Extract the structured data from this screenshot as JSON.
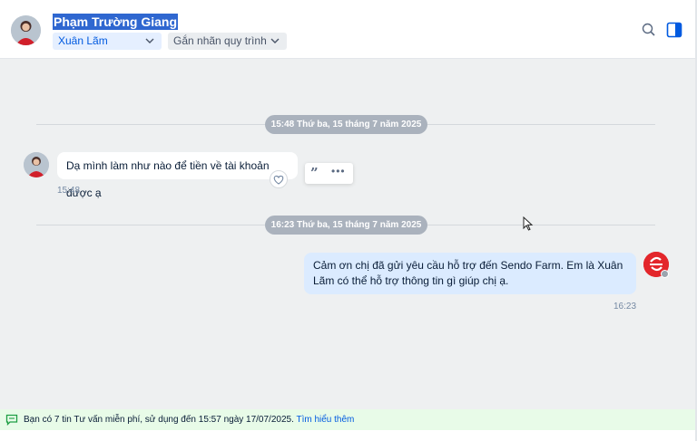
{
  "header": {
    "contact_name": "Phạm Trường Giang",
    "assignee": "Xuân Lãm",
    "label_button": "Gắn nhãn quy trình"
  },
  "chat": {
    "dividers": [
      {
        "label": "15:48 Thứ ba, 15 tháng 7 năm 2025"
      },
      {
        "label": "16:23 Thứ ba, 15 tháng 7 năm 2025"
      }
    ],
    "incoming": {
      "text": "Dạ mình làm như nào để tiền về tài khoản được ạ",
      "time": "15:48"
    },
    "actions": {
      "quote": "”",
      "more": "•••"
    },
    "outgoing": {
      "text": "Cảm ơn chị đã gửi yêu cầu hỗ trợ đến Sendo Farm. Em là Xuân Lãm có thể hỗ trợ thông tin gì giúp chị ạ.",
      "time": "16:23"
    }
  },
  "footer": {
    "notice": "Bạn có 7 tin Tư vấn miễn phí, sử dụng đến 15:57 ngày 17/07/2025.",
    "link": "Tìm hiểu thêm"
  },
  "colors": {
    "accent": "#005ae0",
    "incoming_bubble": "#ffffff",
    "outgoing_bubble": "#dbebff",
    "chat_background": "#eef0f1",
    "footer_background": "#e8fbe8"
  },
  "icons": [
    "avatar",
    "chevron-down-icon",
    "search-icon",
    "side-panel-icon",
    "heart-icon",
    "quote-icon",
    "more-icon",
    "chat-icon",
    "cursor-icon"
  ]
}
